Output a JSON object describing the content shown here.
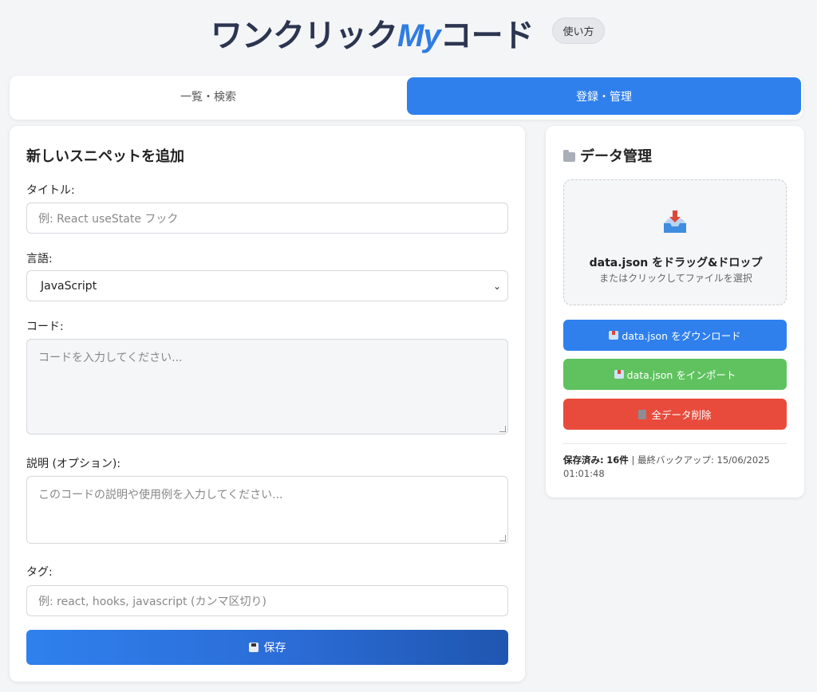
{
  "header": {
    "title_prefix": "ワンクリック",
    "title_my": "My",
    "title_suffix": "コード",
    "help_label": "使い方"
  },
  "tabs": [
    {
      "label": "一覧・検索",
      "active": false
    },
    {
      "label": "登録・管理",
      "active": true
    }
  ],
  "form": {
    "heading": "新しいスニペットを追加",
    "title_label": "タイトル:",
    "title_placeholder": "例: React useState フック",
    "language_label": "言語:",
    "language_value": "JavaScript",
    "code_label": "コード:",
    "code_placeholder": "コードを入力してください...",
    "description_label": "説明 (オプション):",
    "description_placeholder": "このコードの説明や使用例を入力してください...",
    "tags_label": "タグ:",
    "tags_placeholder": "例: react, hooks, javascript (カンマ区切り)",
    "save_label": "保存"
  },
  "data_panel": {
    "heading": "データ管理",
    "dropzone_title": "data.json をドラッグ&ドロップ",
    "dropzone_sub": "またはクリックしてファイルを選択",
    "download_label": "data.json をダウンロード",
    "import_label": "data.json をインポート",
    "delete_label": "全データ削除",
    "stats_saved_label": "保存済み:",
    "stats_saved_value": "16件",
    "stats_backup_label": "| 最終バックアップ: 15/06/2025 01:01:48"
  },
  "colors": {
    "primary": "#2f80ed",
    "success": "#5fc25f",
    "danger": "#e84b3c",
    "title": "#2c3550"
  }
}
